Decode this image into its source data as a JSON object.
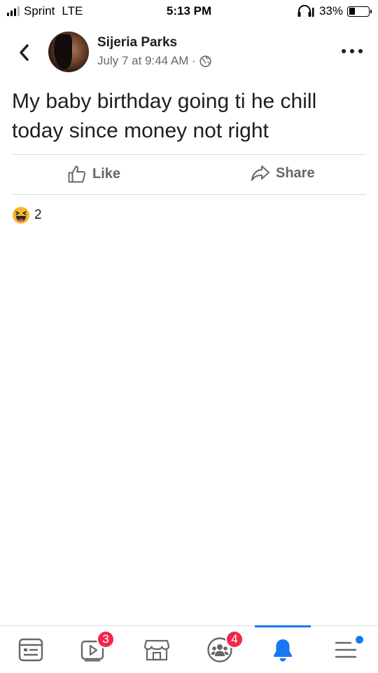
{
  "status_bar": {
    "carrier": "Sprint",
    "network": "LTE",
    "time": "5:13 PM",
    "battery_percent_label": "33%",
    "battery_level": 0.33
  },
  "post": {
    "author": "Sijeria Parks",
    "timestamp": "July 7 at 9:44 AM",
    "separator": "·",
    "privacy_icon": "globe-icon",
    "text": "My baby birthday going ti he chill today since money not right",
    "actions": {
      "like_label": "Like",
      "share_label": "Share"
    },
    "reactions": {
      "icon": "haha-emoji-icon",
      "count": "2"
    }
  },
  "bottom_nav": {
    "items": [
      {
        "icon": "news-feed-icon"
      },
      {
        "icon": "watch-icon",
        "badge": "3"
      },
      {
        "icon": "marketplace-icon"
      },
      {
        "icon": "groups-icon",
        "badge": "4"
      },
      {
        "icon": "notifications-bell-icon",
        "active": true
      },
      {
        "icon": "menu-icon",
        "dot": true
      }
    ]
  },
  "colors": {
    "accent": "#1877f2",
    "badge": "#f02849",
    "secondary_text": "#65676b",
    "divider": "#dadde1"
  }
}
